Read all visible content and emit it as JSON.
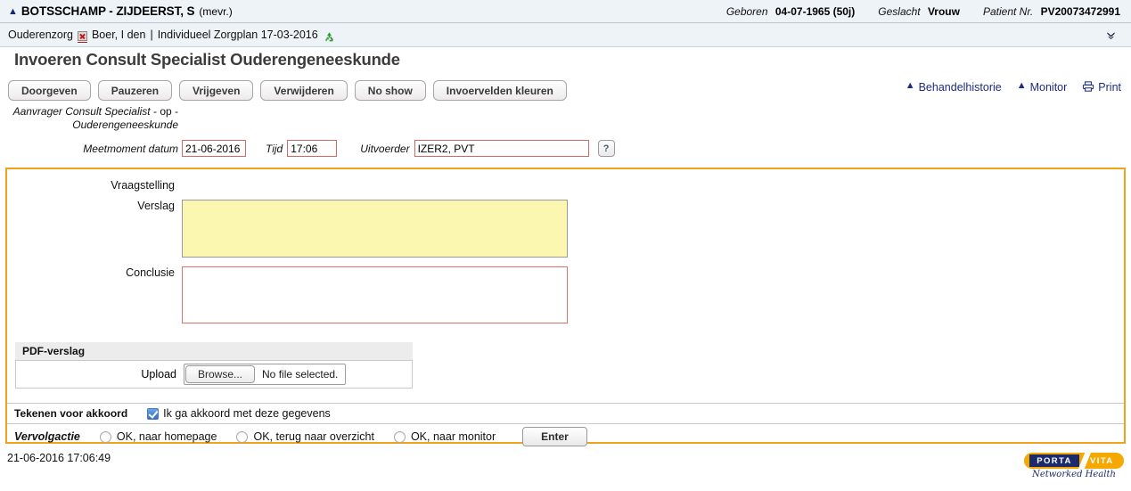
{
  "patient": {
    "collapse_icon": "chevron-up-icon",
    "name": "BOTSSCHAMP - ZIJDEERST, S",
    "salutation": "(mevr.)",
    "fields": [
      {
        "label": "Geboren",
        "value": "04-07-1965 (50j)"
      },
      {
        "label": "Geslacht",
        "value": "Vrouw"
      },
      {
        "label": "Patient Nr.",
        "value": "PV20073472991"
      }
    ]
  },
  "breadcrumb": {
    "program": "Ouderenzorg",
    "close_icon": "red-x-icon",
    "provider": "Boer, I den",
    "separator": "|",
    "careplan": "Individueel Zorgplan 17-03-2016",
    "refresh_icon": "green-recycle-icon",
    "expand_icon": "double-chevron-down-icon"
  },
  "page": {
    "title": "Invoeren Consult Specialist Ouderengeneeskunde"
  },
  "toolbar": {
    "buttons": [
      "Doorgeven",
      "Pauzeren",
      "Vrijgeven",
      "Verwijderen",
      "No show",
      "Invoervelden kleuren"
    ]
  },
  "top_links": [
    {
      "icon": "chevron-up-icon",
      "label": "Behandelhistorie"
    },
    {
      "icon": "chevron-up-icon",
      "label": "Monitor"
    },
    {
      "icon": "printer-icon",
      "label": "Print"
    }
  ],
  "meta": {
    "requester_label_line1": "Aanvrager Consult Specialist",
    "requester_value": "- op -",
    "requester_label_line2": "Ouderengeneeskunde",
    "date_label": "Meetmoment datum",
    "date_value": "21-06-2016",
    "time_label": "Tijd",
    "time_value": "17:06",
    "executor_label": "Uitvoerder",
    "executor_value": "IZER2, PVT",
    "help_label": "?"
  },
  "form": {
    "question_label": "Vraagstelling",
    "report_label": "Verslag",
    "report_value": "",
    "conclusion_label": "Conclusie",
    "conclusion_value": "",
    "pdf_section_title": "PDF-verslag",
    "upload_label": "Upload",
    "browse_label": "Browse...",
    "file_status": "No file selected.",
    "sign_title": "Tekenen voor akkoord",
    "sign_checkbox_label": "Ik ga akkoord met deze gegevens",
    "sign_checked": true,
    "followup_label": "Vervolgactie",
    "followup_options": [
      "OK, naar homepage",
      "OK, terug naar overzicht",
      "OK, naar monitor"
    ],
    "enter_label": "Enter"
  },
  "footer": {
    "timestamp": "21-06-2016 17:06:49",
    "logo_porta": "PORTA",
    "logo_vita": "VITA",
    "logo_tagline": "Networked Health"
  },
  "colors": {
    "panel_border": "#f0a21c",
    "required_field_border": "#d06a66",
    "highlight_field_bg": "#fbf6b0",
    "link": "#1c2d80",
    "header_bg": "#eef3f8",
    "logo_orange": "#f5a800",
    "logo_navy": "#1b2a6b"
  }
}
